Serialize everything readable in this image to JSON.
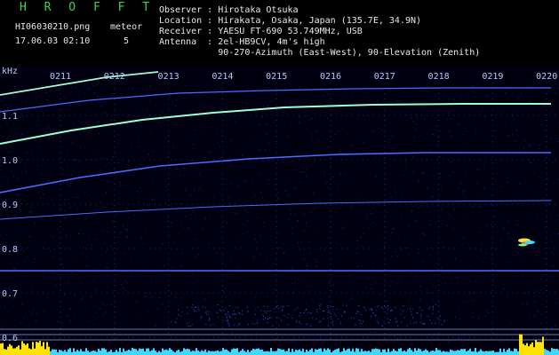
{
  "header": {
    "app_title": "H R O F F T",
    "filename": "HI06030210.png",
    "datetime": "17.06.03 02:10",
    "meteor_label": "meteor",
    "meteor_count": "5",
    "observer_line": "Observer : Hirotaka Otsuka",
    "location_line": "Location : Hirakata, Osaka, Japan (135.7E, 34.9N)",
    "receiver_line": "Receiver : YAESU FT-690 53.749MHz, USB",
    "antenna_line1": "Antenna  : 2el-HB9CV, 4m's high",
    "antenna_line2": "           90-270-Azimuth (East-West), 90-Elevation (Zenith)"
  },
  "colors": {
    "background": "#000000",
    "grid_text": "#b8c8ff",
    "trace": "#4a6cff",
    "trace_bright": "#9fffd0",
    "spectrum": "#ffe400",
    "spectrum_cyan": "#3fd8ff"
  },
  "chart_data": {
    "type": "heatmap",
    "ylabel": "kHz",
    "y_ticks": [
      "1.1",
      "1.0",
      "0.9",
      "0.8",
      "0.7",
      "0.6"
    ],
    "x_ticks": [
      "0211",
      "0212",
      "0213",
      "0214",
      "0215",
      "0216",
      "0217",
      "0218",
      "0219",
      "0220"
    ],
    "ylim": [
      0.58,
      1.21
    ]
  }
}
